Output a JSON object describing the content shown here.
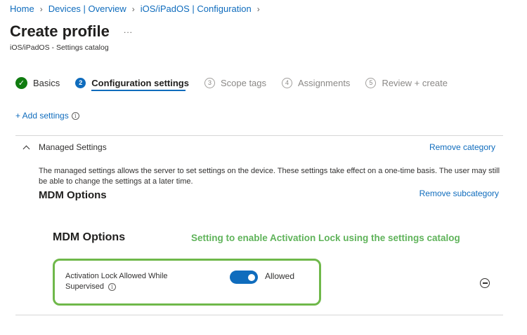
{
  "breadcrumb": {
    "items": [
      "Home",
      "Devices | Overview",
      "iOS/iPadOS | Configuration"
    ],
    "separator": ">"
  },
  "header": {
    "title": "Create profile",
    "more": "...",
    "subtitle": "iOS/iPadOS - Settings catalog"
  },
  "wizard": {
    "steps": [
      {
        "label": "Basics",
        "status": "done",
        "marker": "✓"
      },
      {
        "label": "Configuration settings",
        "status": "active",
        "marker": "2"
      },
      {
        "label": "Scope tags",
        "status": "pending",
        "marker": "3"
      },
      {
        "label": "Assignments",
        "status": "pending",
        "marker": "4"
      },
      {
        "label": "Review + create",
        "status": "pending",
        "marker": "5"
      }
    ]
  },
  "add_settings": {
    "label": "+ Add settings",
    "info": "i"
  },
  "category": {
    "name": "Managed Settings",
    "remove_label": "Remove category",
    "description": "The managed settings allows the server to set settings on the device. These settings take effect on a one-time basis. The user may still be able to change the settings at a later time.",
    "subcategory": {
      "name": "MDM Options",
      "remove_label": "Remove subcategory",
      "inner_title": "MDM Options",
      "annotation": "Setting to enable Activation Lock using the settings catalog",
      "setting": {
        "label_line1": "Activation Lock Allowed While",
        "label_line2": "Supervised",
        "info": "i",
        "toggle_on": true,
        "state": "Allowed"
      }
    }
  },
  "colors": {
    "accent": "#0f6cbd",
    "success": "#107c10",
    "highlight": "#6fb84a",
    "annotation": "#5fb35a"
  }
}
